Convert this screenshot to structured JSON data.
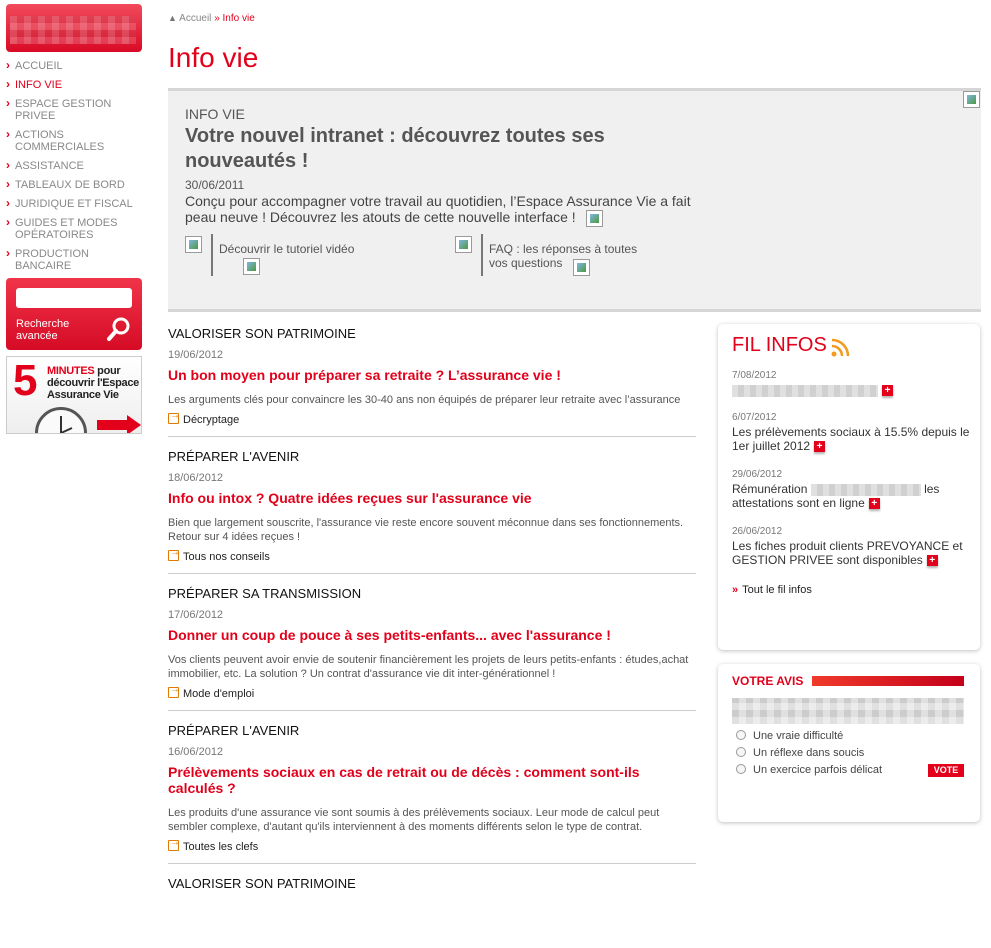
{
  "nav": {
    "items": [
      {
        "label": "ACCUEIL",
        "active": false
      },
      {
        "label": "INFO VIE",
        "active": true
      },
      {
        "label": "ESPACE GESTION\nPRIVEE",
        "active": false
      },
      {
        "label": "ACTIONS\nCOMMERCIALES",
        "active": false
      },
      {
        "label": "ASSISTANCE",
        "active": false
      },
      {
        "label": "TABLEAUX DE BORD",
        "active": false
      },
      {
        "label": "JURIDIQUE ET FISCAL",
        "active": false
      },
      {
        "label": "GUIDES ET MODES\nOPÉRATOIRES",
        "active": false
      },
      {
        "label": "PRODUCTION\nBANCAIRE",
        "active": false
      }
    ]
  },
  "search": {
    "placeholder": "",
    "label": "Recherche avancée"
  },
  "promo": {
    "number": "5",
    "highlight": "MINUTES",
    "line1": " pour",
    "line2": "découvrir l'Espace",
    "line3": "Assurance Vie"
  },
  "breadcrumb": {
    "home": "Accueil",
    "separator": "»",
    "current": "Info vie"
  },
  "page_title": "Info vie",
  "hero": {
    "kicker": "INFO VIE",
    "title": "Votre nouvel intranet : découvrez toutes ses nouveautés !",
    "date": "30/06/2011",
    "text": "Conçu pour accompagner votre travail au quotidien, l’Espace Assurance Vie a fait peau neuve ! Découvrez les atouts de cette nouvelle interface !",
    "links": [
      {
        "label": "Découvrir le tutoriel vidéo"
      },
      {
        "label": "FAQ : les réponses à toutes\nvos questions"
      }
    ]
  },
  "articles": [
    {
      "category": "VALORISER SON PATRIMOINE",
      "date": "19/06/2012",
      "title": "Un bon moyen pour préparer sa retraite ? L’assurance vie !",
      "desc": "Les arguments clés pour convaincre les 30-40 ans non équipés de préparer leur retraite avec l’assurance",
      "more": "Décryptage"
    },
    {
      "category": "PRÉPARER L'AVENIR",
      "date": "18/06/2012",
      "title": "Info ou intox ? Quatre idées reçues sur l'assurance vie",
      "desc": "Bien que largement souscrite, l'assurance vie reste encore souvent méconnue dans ses fonctionnements. Retour sur 4 idées reçues !",
      "more": "Tous nos conseils"
    },
    {
      "category": "PRÉPARER SA TRANSMISSION",
      "date": "17/06/2012",
      "title": "Donner un coup de pouce à ses petits-enfants... avec l'assurance !",
      "desc": "Vos clients peuvent avoir envie de soutenir financièrement les projets de leurs petits-enfants : études,achat immobilier, etc. La solution ? Un contrat d'assurance vie dit inter-générationnel !",
      "more": "Mode d'emploi"
    },
    {
      "category": "PRÉPARER L'AVENIR",
      "date": "16/06/2012",
      "title": "Prélèvements sociaux en cas de retrait ou de décès : comment sont-ils calculés ?",
      "desc": "Les produits d'une assurance vie sont soumis à des prélèvements sociaux. Leur mode de calcul peut sembler complexe, d'autant qu'ils interviennent à des moments différents selon le type de contrat.",
      "more": "Toutes les clefs"
    },
    {
      "category": "VALORISER SON PATRIMOINE",
      "date": "",
      "title": "",
      "desc": "",
      "more": ""
    }
  ],
  "fil_infos": {
    "title": "FIL INFOS",
    "items": [
      {
        "date": "7/08/2012",
        "text": ""
      },
      {
        "date": "6/07/2012",
        "text": "Les prélèvements sociaux à 15.5% depuis le 1er juillet 2012"
      },
      {
        "date": "29/06/2012",
        "text_before": "Rémunération",
        "text_after": "les attestations sont en ligne"
      },
      {
        "date": "26/06/2012",
        "text": "Les fiches produit clients PREVOYANCE et GESTION PRIVEE sont disponibles"
      }
    ],
    "all_link": "Tout le fil infos"
  },
  "avis": {
    "title": "VOTRE AVIS",
    "options": [
      "Une vraie difficulté",
      "Un réflexe dans soucis",
      "Un exercice parfois délicat"
    ],
    "vote_label": "VOTE"
  },
  "colors": {
    "accent": "#e2001a",
    "panel": "#f0f0f0"
  }
}
